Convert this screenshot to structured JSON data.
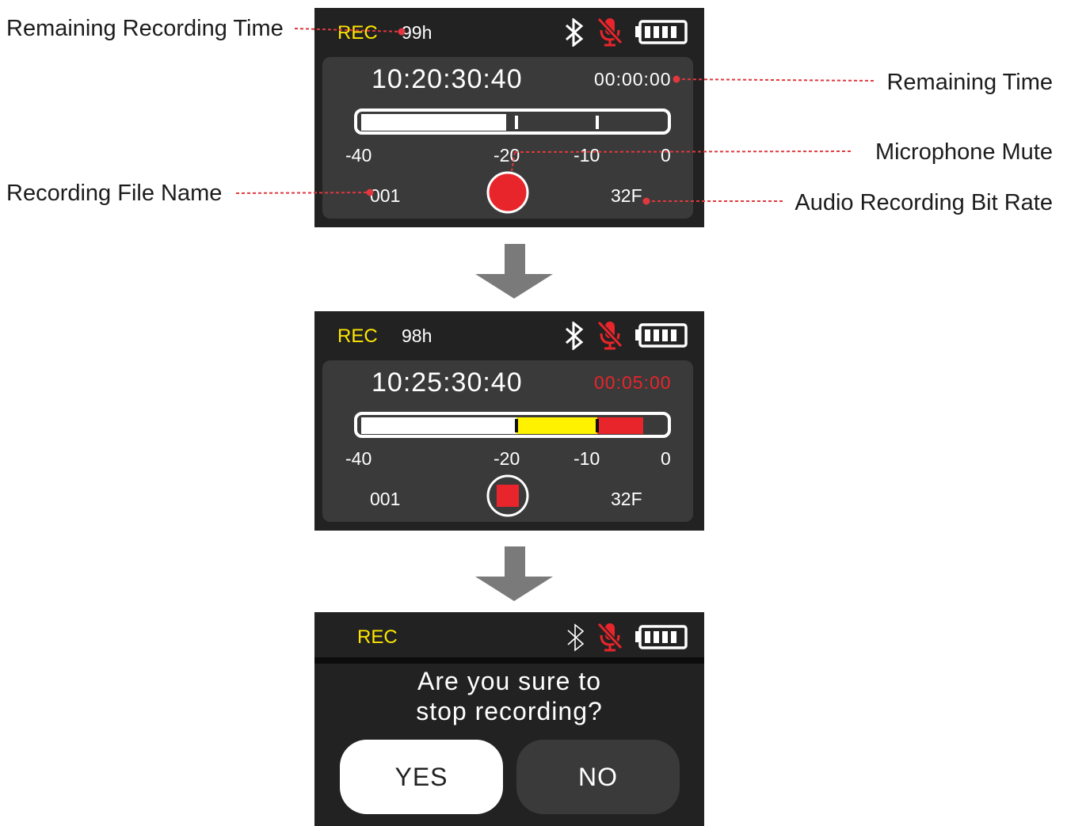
{
  "screens": [
    {
      "rec_label": "REC",
      "remaining_hours": "99h",
      "clock": "10:20:30:40",
      "remaining_time": "00:00:00",
      "remaining_time_color": "#ffffff",
      "meter_levels": [
        -40,
        -20,
        -10,
        0
      ],
      "scale_labels": [
        "-40",
        "-20",
        "-10",
        "0"
      ],
      "file_name": "001",
      "bit_rate": "32F",
      "record_button_state": "ready"
    },
    {
      "rec_label": "REC",
      "remaining_hours": "98h",
      "clock": "10:25:30:40",
      "remaining_time": "00:05:00",
      "remaining_time_color": "#e8252b",
      "scale_labels": [
        "-40",
        "-20",
        "-10",
        "0"
      ],
      "file_name": "001",
      "bit_rate": "32F",
      "record_button_state": "recording"
    },
    {
      "rec_label": "REC",
      "dialog_line1": "Are you sure to",
      "dialog_line2": "stop recording?",
      "yes_label": "YES",
      "no_label": "NO"
    }
  ],
  "callouts": {
    "remaining_recording_time": "Remaining Recording Time",
    "remaining_time": "Remaining Time",
    "microphone_mute": "Microphone Mute",
    "recording_file_name": "Recording File Name",
    "audio_recording_bit_rate": "Audio Recording Bit Rate"
  },
  "icons": [
    "bluetooth-icon",
    "microphone-mute-icon",
    "battery-icon",
    "record-button-icon",
    "stop-button-icon",
    "down-arrow-icon"
  ],
  "colors": {
    "rec_yellow": "#ffe600",
    "alert_red": "#e8252b",
    "screen_bg": "#222222",
    "panel_bg": "#3a3a3a",
    "meter_yellow": "#fff200",
    "arrow_gray": "#7a7a7a",
    "leader_red": "#e0383e"
  }
}
